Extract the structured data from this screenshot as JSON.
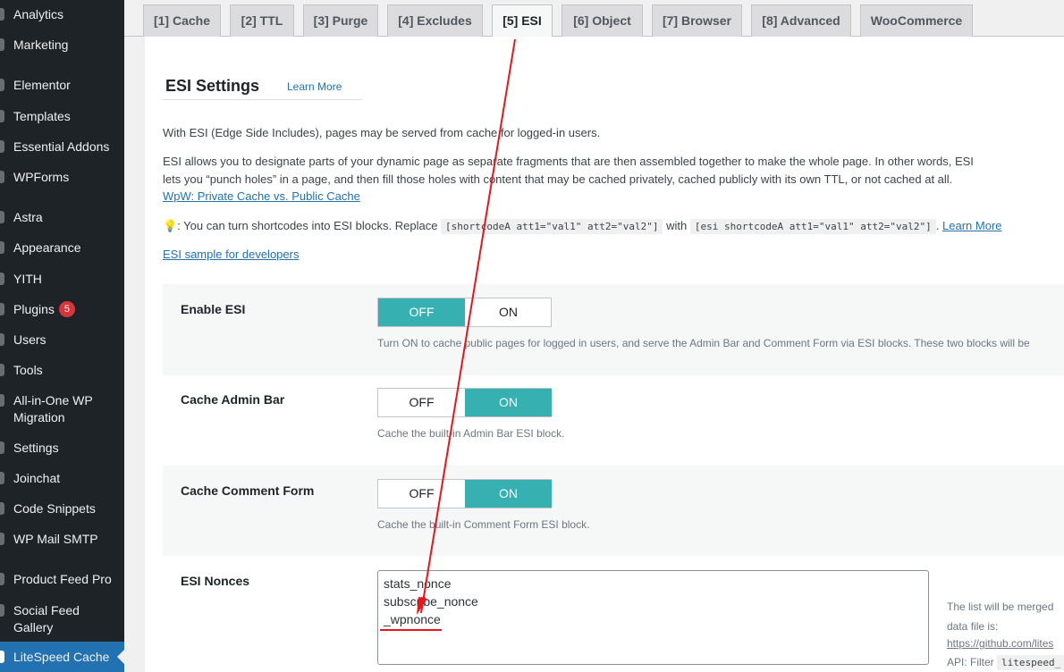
{
  "sidebar": {
    "items": [
      {
        "label": "Analytics"
      },
      {
        "label": "Marketing"
      },
      {
        "label": "Elementor"
      },
      {
        "label": "Templates"
      },
      {
        "label": "Essential Addons"
      },
      {
        "label": "WPForms"
      },
      {
        "label": "Astra"
      },
      {
        "label": "Appearance"
      },
      {
        "label": "YITH"
      },
      {
        "label": "Plugins",
        "badge": "5"
      },
      {
        "label": "Users"
      },
      {
        "label": "Tools"
      },
      {
        "label": "All-in-One WP",
        "label2": "Migration"
      },
      {
        "label": "Settings"
      },
      {
        "label": "Joinchat"
      },
      {
        "label": "Code Snippets"
      },
      {
        "label": "WP Mail SMTP"
      },
      {
        "label": "Product Feed Pro"
      },
      {
        "label": "Social Feed",
        "label2": "Gallery"
      },
      {
        "label": "LiteSpeed Cache"
      }
    ]
  },
  "tabs": [
    {
      "label": "[1] Cache"
    },
    {
      "label": "[2] TTL"
    },
    {
      "label": "[3] Purge"
    },
    {
      "label": "[4] Excludes"
    },
    {
      "label": "[5] ESI",
      "active": true
    },
    {
      "label": "[6] Object"
    },
    {
      "label": "[7] Browser"
    },
    {
      "label": "[8] Advanced"
    },
    {
      "label": "WooCommerce"
    }
  ],
  "section": {
    "title": "ESI Settings",
    "learn_more": "Learn More"
  },
  "intro": {
    "p1": "With ESI (Edge Side Includes), pages may be served from cache for logged-in users.",
    "p2a": "ESI allows you to designate parts of your dynamic page as separate fragments that are then assembled together to make the whole page. In other words, ESI",
    "p2b": "lets you “punch holes” in a page, and then fill those holes with content that may be cached privately, cached publicly with its own TTL, or not cached at all.",
    "p2_link": "WpW: Private Cache vs. Public Cache",
    "tip_icon": "💡",
    "tip_text": ": You can turn shortcodes into ESI blocks. Replace",
    "tip_code1": "[shortcodeA att1=\"val1\" att2=\"val2\"]",
    "tip_with": "with",
    "tip_code2": "[esi shortcodeA att1=\"val1\" att2=\"val2\"]",
    "tip_dot": ".",
    "tip_link": "Learn More",
    "sample_link": "ESI sample for developers"
  },
  "settings": {
    "enable_esi": {
      "label": "Enable ESI",
      "off": "OFF",
      "on": "ON",
      "value": "OFF",
      "hint": "Turn ON to cache public pages for logged in users, and serve the Admin Bar and Comment Form via ESI blocks. These two blocks will be"
    },
    "cache_admin_bar": {
      "label": "Cache Admin Bar",
      "off": "OFF",
      "on": "ON",
      "value": "ON",
      "hint": "Cache the built-in Admin Bar ESI block."
    },
    "cache_comment_form": {
      "label": "Cache Comment Form",
      "off": "OFF",
      "on": "ON",
      "value": "ON",
      "hint": "Cache the built-in Comment Form ESI block."
    },
    "esi_nonces": {
      "label": "ESI Nonces",
      "value": "stats_nonce\nsubscribe_nonce\n_wpnonce",
      "note1": "The list will be merged",
      "note2": "data file is:",
      "note_link": "https://github.com/lites",
      "note_api": "API: Filter",
      "note_code": "litespeed_"
    }
  },
  "colors": {
    "toggle_selected": "#36b0b0",
    "link": "#2271b1",
    "annotation": "#e8161b"
  }
}
